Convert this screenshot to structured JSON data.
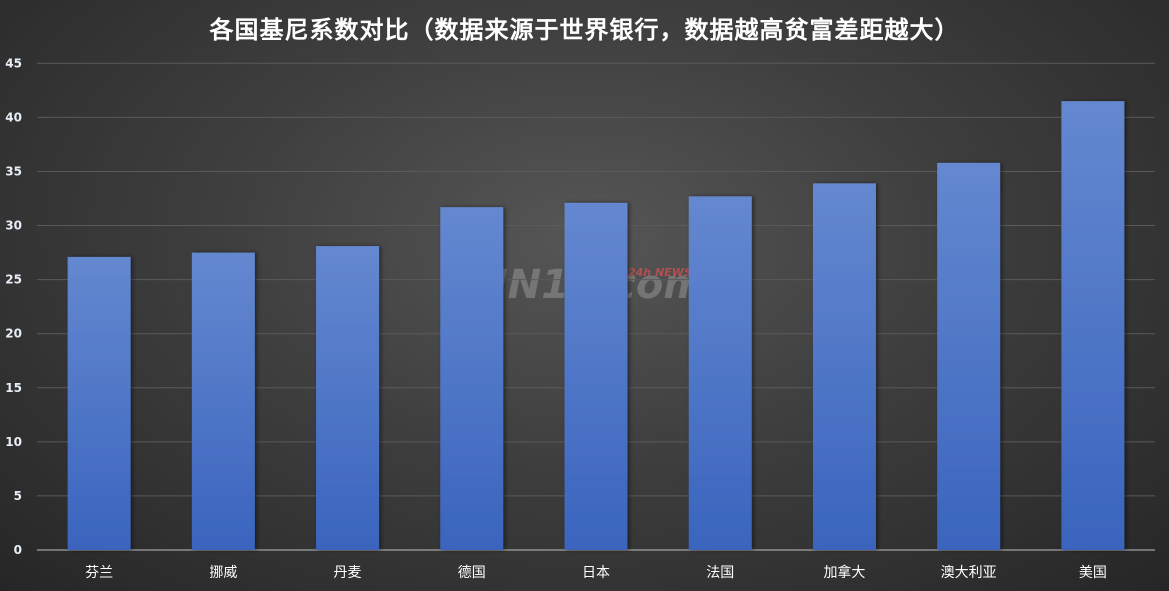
{
  "watermark": {
    "text": "JIN10.com",
    "badge": "24h NEWS"
  },
  "chart_data": {
    "type": "bar",
    "title": "各国基尼系数对比（数据来源于世界银行，数据越高贫富差距越大）",
    "xlabel": "",
    "ylabel": "",
    "categories": [
      "芬兰",
      "挪威",
      "丹麦",
      "德国",
      "日本",
      "法国",
      "加拿大",
      "澳大利亚",
      "美国"
    ],
    "values": [
      27.1,
      27.5,
      28.1,
      31.7,
      32.1,
      32.7,
      33.9,
      35.8,
      41.5
    ],
    "ylim": [
      0,
      45
    ],
    "yticks": [
      0,
      5,
      10,
      15,
      20,
      25,
      30,
      35,
      40,
      45
    ],
    "grid": true,
    "legend": "none",
    "bar_color": "#5b80cc",
    "background": "#3c3c3c"
  }
}
